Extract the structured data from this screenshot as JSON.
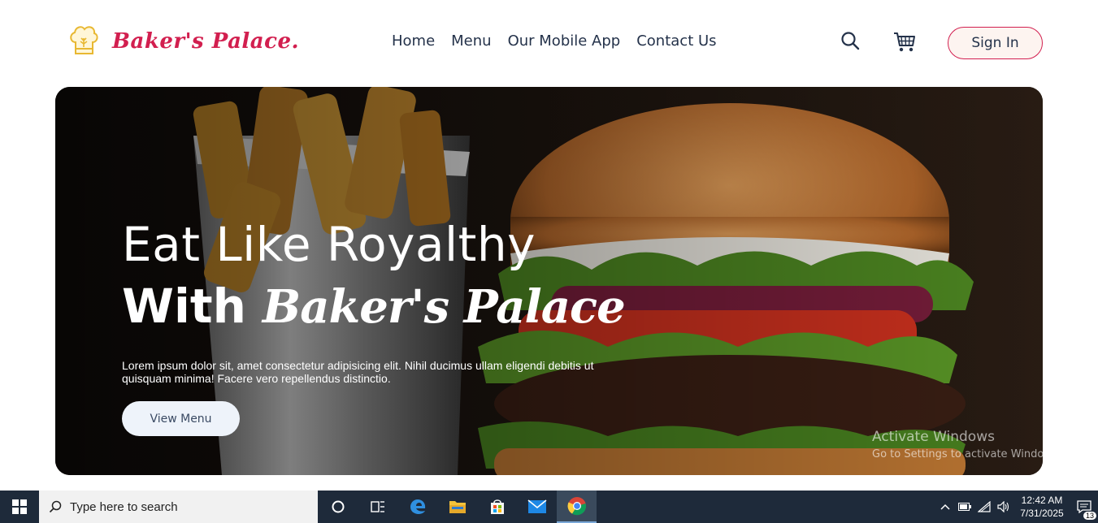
{
  "brand": {
    "name": "Baker's Palace.",
    "accent": "#d21f4f",
    "logo_icon": "chef-hat-icon"
  },
  "nav": {
    "items": [
      {
        "label": "Home"
      },
      {
        "label": "Menu"
      },
      {
        "label": "Our Mobile App"
      },
      {
        "label": "Contact Us"
      }
    ]
  },
  "header_actions": {
    "search_icon": "search-icon",
    "cart_icon": "cart-icon",
    "signin_label": "Sign In"
  },
  "hero": {
    "title_line1": "Eat Like Royalthy",
    "title_line2_prefix": "With",
    "title_line2_script": "Baker's Palace",
    "description": "Lorem ipsum dolor sit, amet consectetur adipisicing elit. Nihil ducimus ullam eligendi debitis ut quisquam minima! Facere vero repellendus distinctio.",
    "button_label": "View Menu"
  },
  "watermark": {
    "title": "Activate Windows",
    "subtitle": "Go to Settings to activate Windows."
  },
  "taskbar": {
    "search_placeholder": "Type here to search",
    "apps": [
      "cortana-icon",
      "task-view-icon",
      "edge-icon",
      "file-explorer-icon",
      "store-icon",
      "mail-icon",
      "chrome-icon"
    ],
    "time": "12:42 AM",
    "date": "7/31/2025",
    "notification_count": "13"
  }
}
